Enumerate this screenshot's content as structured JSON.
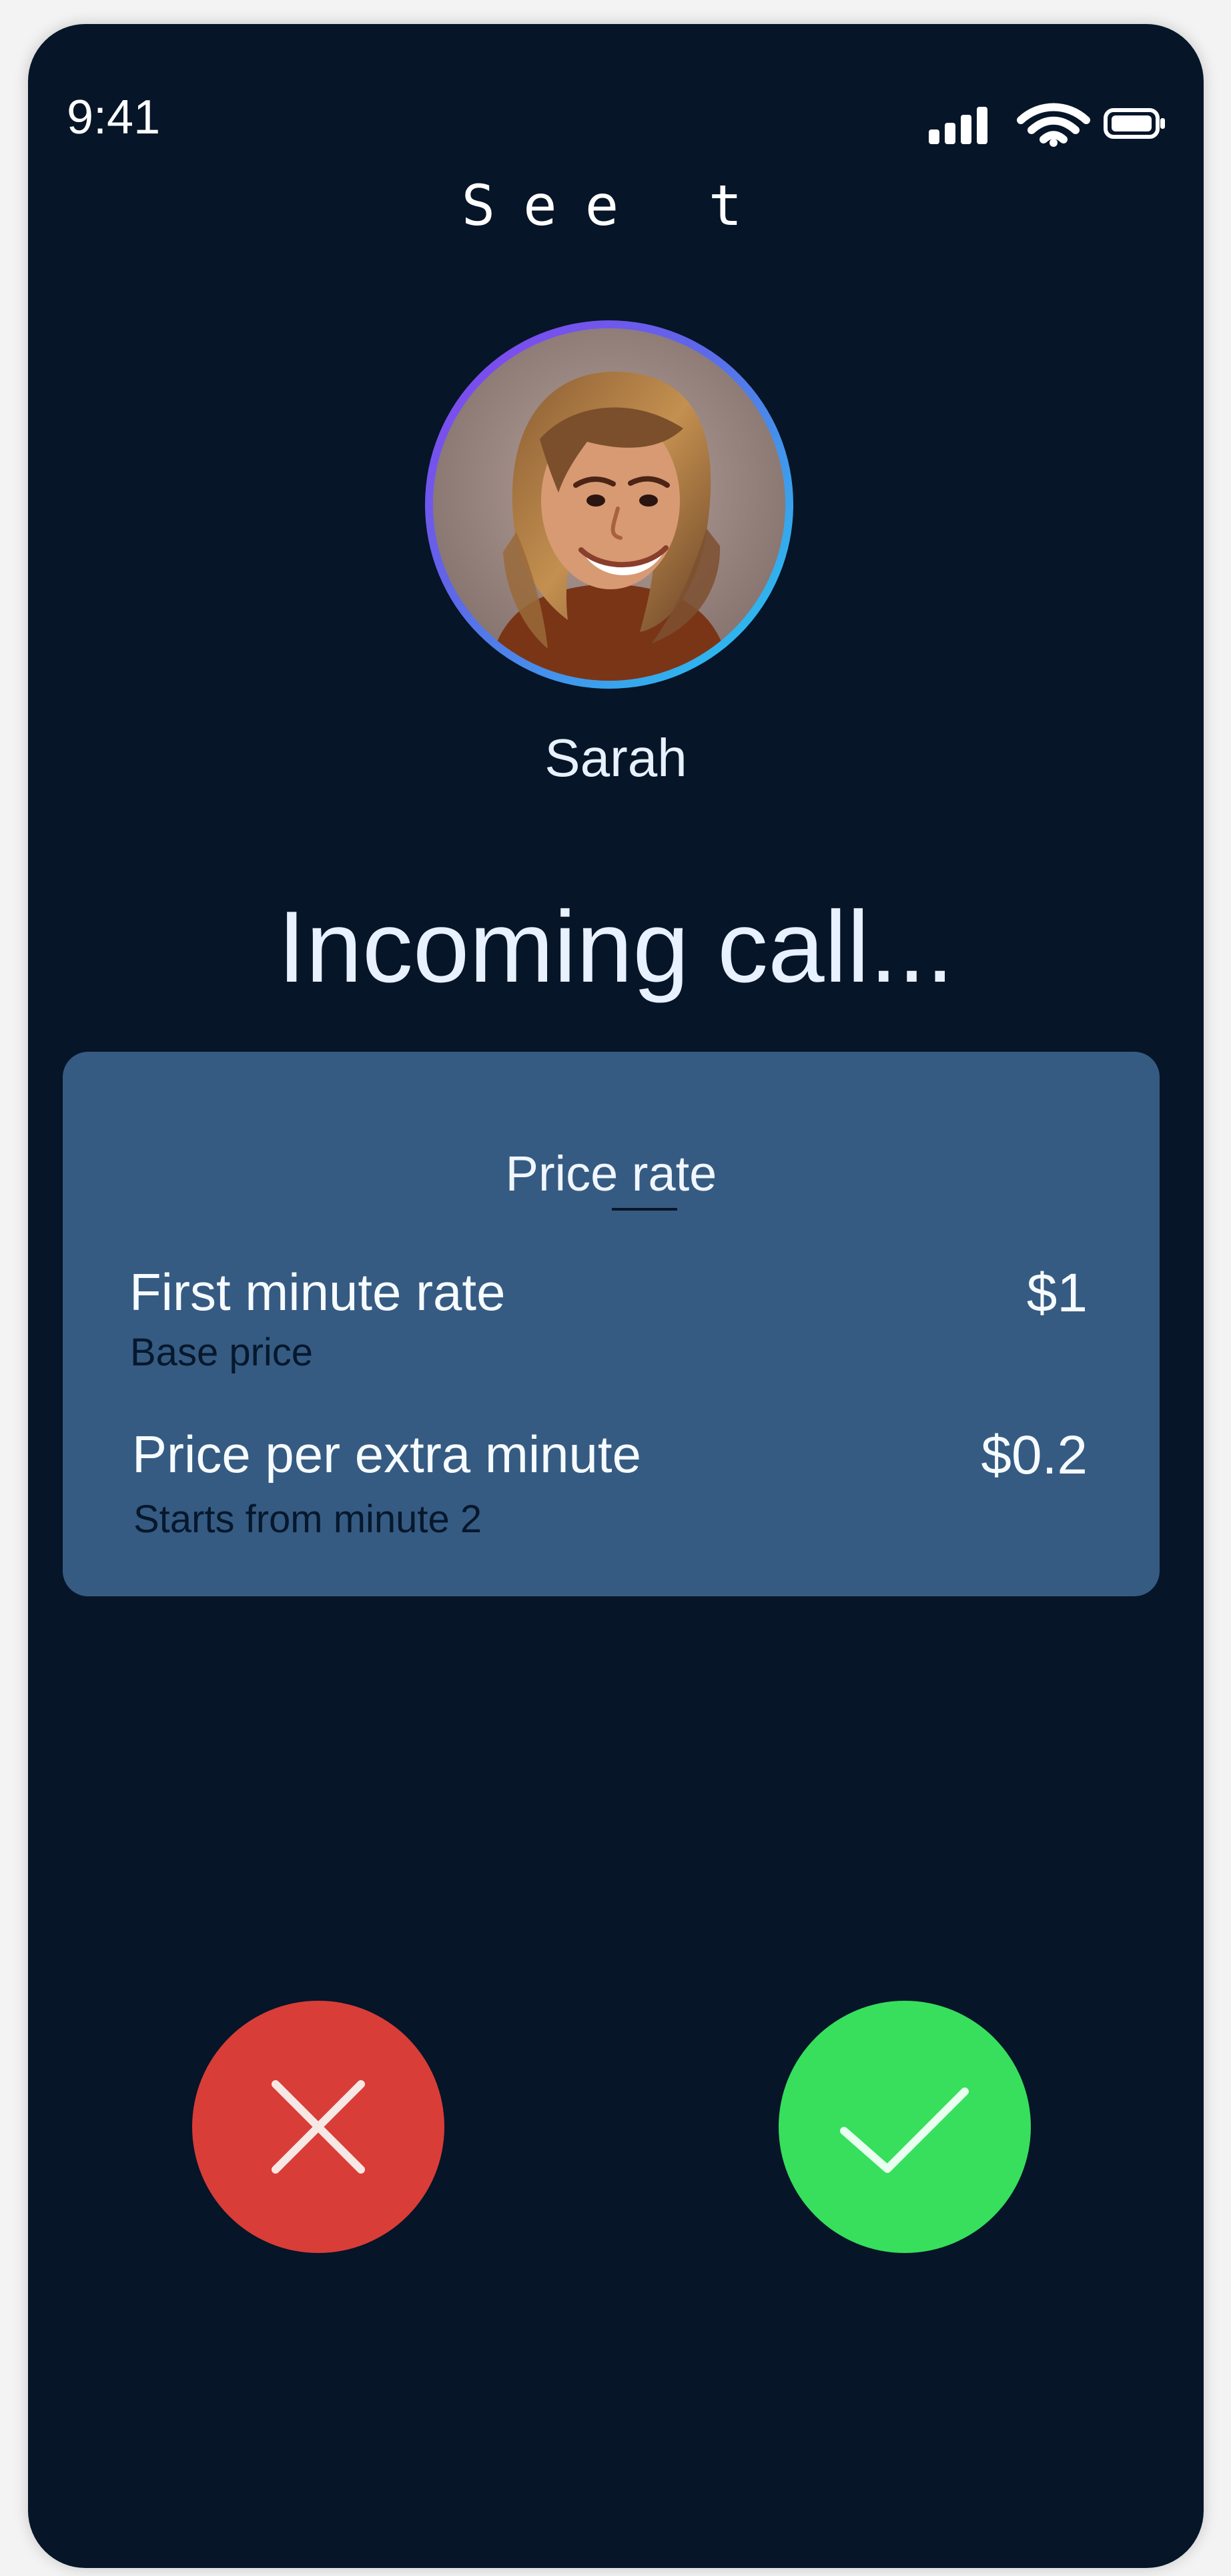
{
  "status_bar": {
    "time": "9:41",
    "signal_icon": "cellular-signal-icon",
    "wifi_icon": "wifi-icon",
    "battery_icon": "battery-icon"
  },
  "app": {
    "logo_text": "See t"
  },
  "caller": {
    "name": "Sarah",
    "avatar": "caller-avatar-photo"
  },
  "call": {
    "status": "Incoming call..."
  },
  "price_rate": {
    "title": "Price rate",
    "rows": [
      {
        "label": "First minute rate",
        "sub": "Base price",
        "value": "$1"
      },
      {
        "label": "Price per extra minute",
        "sub": "Starts from minute 2",
        "value": "$0.2"
      }
    ]
  },
  "actions": {
    "decline_icon": "close-icon",
    "accept_icon": "checkmark-icon",
    "decline_color": "#d93d38",
    "accept_color": "#37df5d"
  },
  "colors": {
    "background": "#061528",
    "card": "#365b82",
    "avatar_ring_start": "#8b3ff2",
    "avatar_ring_end": "#1ecff0"
  }
}
